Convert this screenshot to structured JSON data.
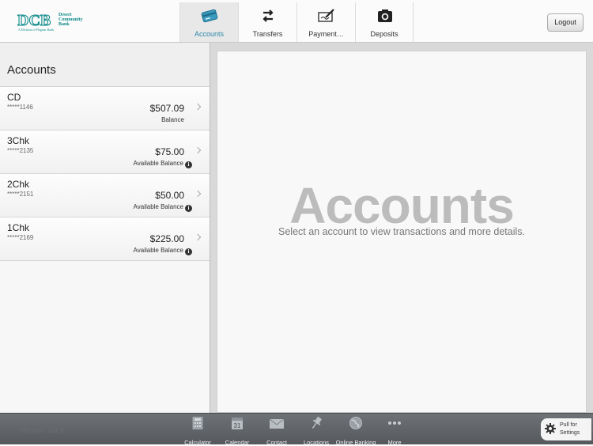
{
  "logo": {
    "mark": "DCB",
    "name_lines": [
      "Desert",
      "Community",
      "Bank"
    ],
    "subtitle": "A Division of Flagstar Bank"
  },
  "tabs": [
    {
      "label": "Accounts",
      "icon": "credit-card-icon",
      "active": true
    },
    {
      "label": "Transfers",
      "icon": "transfer-arrows-icon",
      "active": false
    },
    {
      "label": "Payment…",
      "icon": "check-pen-icon",
      "active": false
    },
    {
      "label": "Deposits",
      "icon": "camera-icon",
      "active": false
    }
  ],
  "logout_label": "Logout",
  "left_panel": {
    "title": "Accounts",
    "accounts": [
      {
        "name": "CD",
        "number": "*****1146",
        "amount": "$507.09",
        "balance_label": "Balance",
        "info": false
      },
      {
        "name": "3Chk",
        "number": "*****2135",
        "amount": "$75.00",
        "balance_label": "Available Balance",
        "info": true
      },
      {
        "name": "2Chk",
        "number": "*****2151",
        "amount": "$50.00",
        "balance_label": "Available Balance",
        "info": true
      },
      {
        "name": "1Chk",
        "number": "*****2169",
        "amount": "$225.00",
        "balance_label": "Available Balance",
        "info": true
      }
    ]
  },
  "main": {
    "title": "Accounts",
    "subtitle": "Select an account to view transactions and more details."
  },
  "bottom": {
    "version": "Version: 3.0.3",
    "items": [
      {
        "label": "Calculator",
        "icon": "calculator-icon"
      },
      {
        "label": "Calendar",
        "icon": "calendar-icon",
        "icon_text": "31"
      },
      {
        "label": "Contact",
        "icon": "envelope-icon"
      },
      {
        "label": "Locations",
        "icon": "pin-icon"
      },
      {
        "label": "Online Banking",
        "icon": "globe-icon"
      },
      {
        "label": "More",
        "icon": "more-dots-icon"
      }
    ],
    "settings": {
      "line1": "Pull for",
      "line2": "Settings"
    }
  },
  "colors": {
    "brand_teal": "#0f8a8a",
    "active_tab_text": "#2f88a8",
    "bottom_bar": "#5f6367"
  }
}
